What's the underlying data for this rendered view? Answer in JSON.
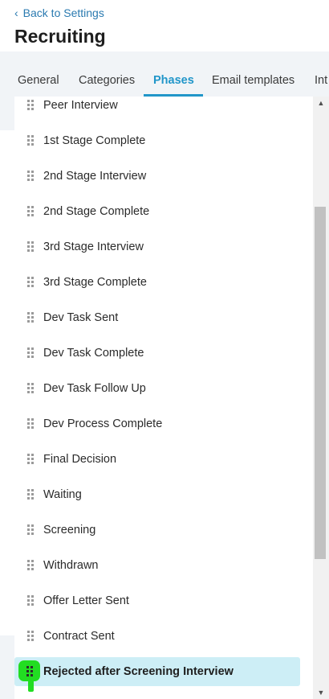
{
  "header": {
    "back_label": "Back to Settings",
    "title": "Recruiting"
  },
  "tabs": [
    {
      "label": "General",
      "active": false
    },
    {
      "label": "Categories",
      "active": false
    },
    {
      "label": "Phases",
      "active": true
    },
    {
      "label": "Email templates",
      "active": false
    },
    {
      "label": "Int",
      "active": false
    }
  ],
  "phases": [
    {
      "label": "Peer Interview"
    },
    {
      "label": "1st Stage Complete"
    },
    {
      "label": "2nd Stage Interview"
    },
    {
      "label": "2nd Stage Complete"
    },
    {
      "label": "3rd Stage Interview"
    },
    {
      "label": "3rd Stage Complete"
    },
    {
      "label": "Dev Task Sent"
    },
    {
      "label": "Dev Task Complete"
    },
    {
      "label": "Dev Task Follow Up"
    },
    {
      "label": "Dev Process Complete"
    },
    {
      "label": "Final Decision"
    },
    {
      "label": "Waiting"
    },
    {
      "label": "Screening"
    },
    {
      "label": "Withdrawn"
    },
    {
      "label": "Offer Letter Sent"
    },
    {
      "label": "Contract Sent"
    },
    {
      "label": "Rejected after Screening Interview",
      "selected": true
    }
  ],
  "colors": {
    "accent": "#2196c9",
    "link": "#2a7ab0",
    "selected_row": "#cdeef6",
    "drag_cursor": "#22dd22"
  },
  "icons": {
    "back": "chevron-left-icon",
    "handle": "drag-handle-icon",
    "scroll_up": "triangle-up-icon",
    "scroll_down": "triangle-down-icon"
  }
}
